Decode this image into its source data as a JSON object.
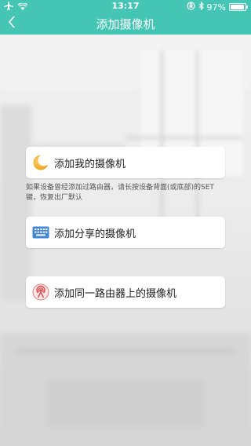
{
  "status_bar": {
    "time": "13:17",
    "battery_text": "97%",
    "battery_level": 0.97
  },
  "nav": {
    "title": "添加摄像机"
  },
  "options": [
    {
      "label": "添加我的摄像机",
      "icon": "moon-camera-icon"
    },
    {
      "label": "添加分享的摄像机",
      "icon": "keyboard-icon"
    },
    {
      "label": "添加同一路由器上的摄像机",
      "icon": "router-signal-icon"
    }
  ],
  "hint": "如果设备曾经添加过路由器，请长按设备背面(或底部)的SET键，恢复出厂默认",
  "colors": {
    "accent": "#45c6b4",
    "card_bg": "#ffffff"
  }
}
